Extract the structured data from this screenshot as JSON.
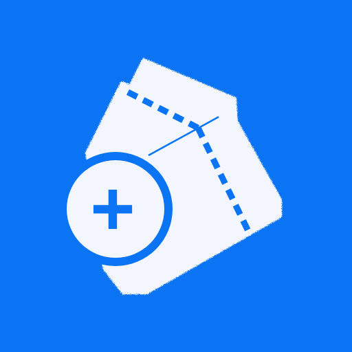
{
  "icon": {
    "name": "add-ticket-icon",
    "glyph": "+",
    "colors": {
      "background": "#0a74f5",
      "paper": "#f3f7fd",
      "accent": "#0a74f5"
    }
  }
}
